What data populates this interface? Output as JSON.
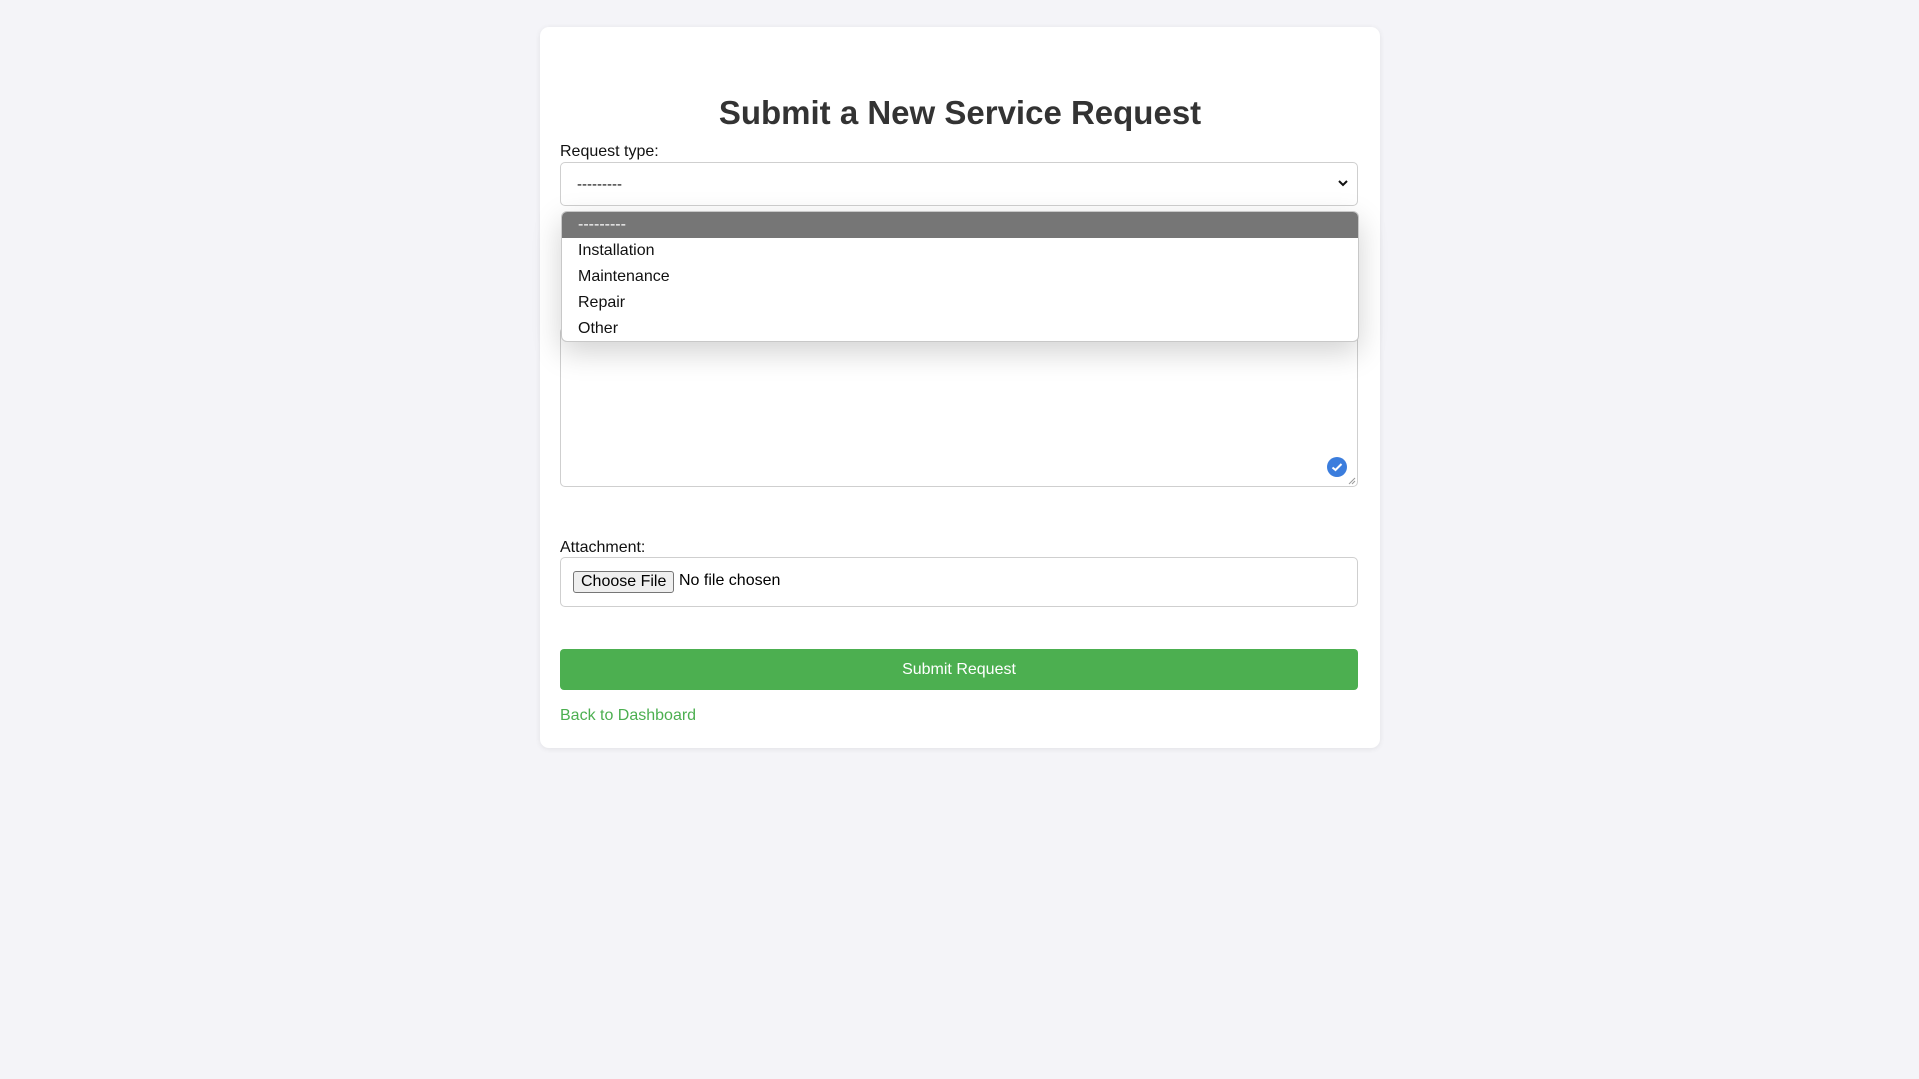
{
  "page": {
    "title": "Submit a New Service Request"
  },
  "form": {
    "request_type_label": "Request type:",
    "request_type_value": "---------",
    "request_type_options": [
      "---------",
      "Installation",
      "Maintenance",
      "Repair",
      "Other"
    ],
    "attachment_label": "Attachment:",
    "file_button_label": "Choose File",
    "file_status": "No file chosen",
    "submit_label": "Submit Request",
    "back_link_label": "Back to Dashboard"
  },
  "colors": {
    "accent": "#4caf50",
    "selected_option_bg": "#767676",
    "check_badge": "#3b7ddd",
    "background": "#f4f4f8"
  },
  "icons": {
    "select_chevron": "chevron-down-icon",
    "textarea_badge": "check-circle-icon",
    "resize_handle": "resize-grip-icon"
  }
}
